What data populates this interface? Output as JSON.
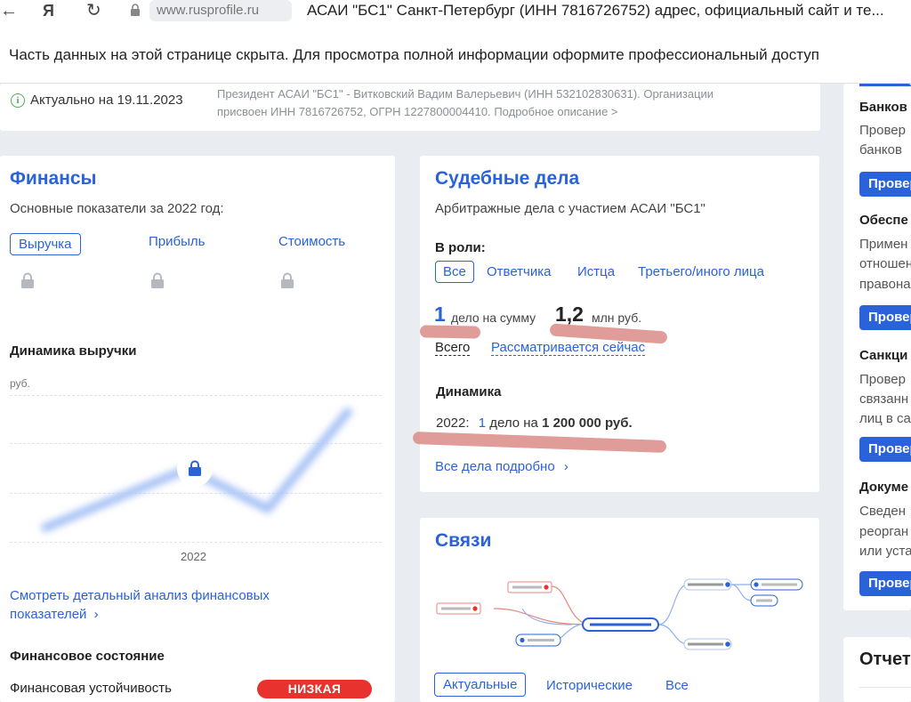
{
  "browser": {
    "url": "www.rusprofile.ru",
    "tab_title": "АСАИ \"БС1\" Санкт-Петербург (ИНН 7816726752) адрес, официальный сайт и те..."
  },
  "banner": {
    "text": "Часть данных на этой странице скрыта. Для просмотра полной информации оформите профессиональный доступ"
  },
  "info": {
    "actual": "Актуально на 19.11.2023",
    "president_line1": "Президент АСАИ \"БС1\" - Витковский Вадим Валерьевич (ИНН 532102830631). Организации",
    "president_line2": "присвоен ИНН 7816726752, ОГРН 1227800004410. Подробное описание >"
  },
  "finance": {
    "title": "Финансы",
    "subtitle": "Основные показатели за 2022 год:",
    "tabs": [
      "Выручка",
      "Прибыль",
      "Стоимость"
    ],
    "dynamics_title": "Динамика выручки",
    "unit": "руб.",
    "year": "2022",
    "link": "Смотреть детальный анализ финансовых показателей",
    "link_arrow": "›",
    "state_title": "Финансовое состояние",
    "stability_label": "Финансовая устойчивость",
    "stability_value": "НИЗКАЯ"
  },
  "court": {
    "title": "Судебные дела",
    "subtitle": "Арбитражные дела с участием АСАИ \"БС1\"",
    "role_label": "В роли:",
    "roles": [
      "Все",
      "Ответчика",
      "Истца",
      "Третьего/иного лица"
    ],
    "count": "1",
    "count_text": "дело на сумму",
    "amount": "1,2",
    "amount_unit": "млн руб.",
    "filter_all": "Всего",
    "filter_current": "Рассматривается сейчас",
    "dynamics_title": "Динамика",
    "dyn_year": "2022:",
    "dyn_count": "1",
    "dyn_text": "дело на",
    "dyn_amount": "1 200 000 руб.",
    "all_link": "Все дела подробно",
    "all_arrow": "›"
  },
  "links": {
    "title": "Связи",
    "tabs": [
      "Актуальные",
      "Исторические",
      "Все"
    ]
  },
  "sidebar": {
    "sections": [
      {
        "title": "Банков",
        "text": [
          "Провер",
          "банков"
        ],
        "button": "Провер"
      },
      {
        "title": "Обеспе",
        "text": [
          "Примен",
          "отношен",
          "правона"
        ],
        "button": "Провер"
      },
      {
        "title": "Санкци",
        "text": [
          "Провер",
          "связанн",
          "лиц в са"
        ],
        "button": "Провер"
      },
      {
        "title": "Докуме",
        "text": [
          "Сведен",
          "реорган",
          "или уста"
        ],
        "button": "Провер"
      }
    ],
    "bottom_title": "Отчет"
  },
  "colors": {
    "accent": "#2a62d9",
    "danger": "#e8322e",
    "scribble": "#d98b86"
  }
}
